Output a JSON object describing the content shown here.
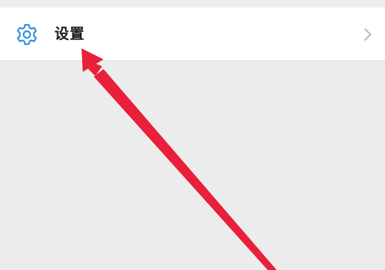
{
  "settings_item": {
    "label": "设置",
    "icon": "gear-icon",
    "trailing_icon": "chevron-right-icon"
  },
  "colors": {
    "icon_accent": "#2f8fdc",
    "annotation_arrow": "#e8203a",
    "row_background": "#ffffff",
    "page_background": "#ececec"
  }
}
